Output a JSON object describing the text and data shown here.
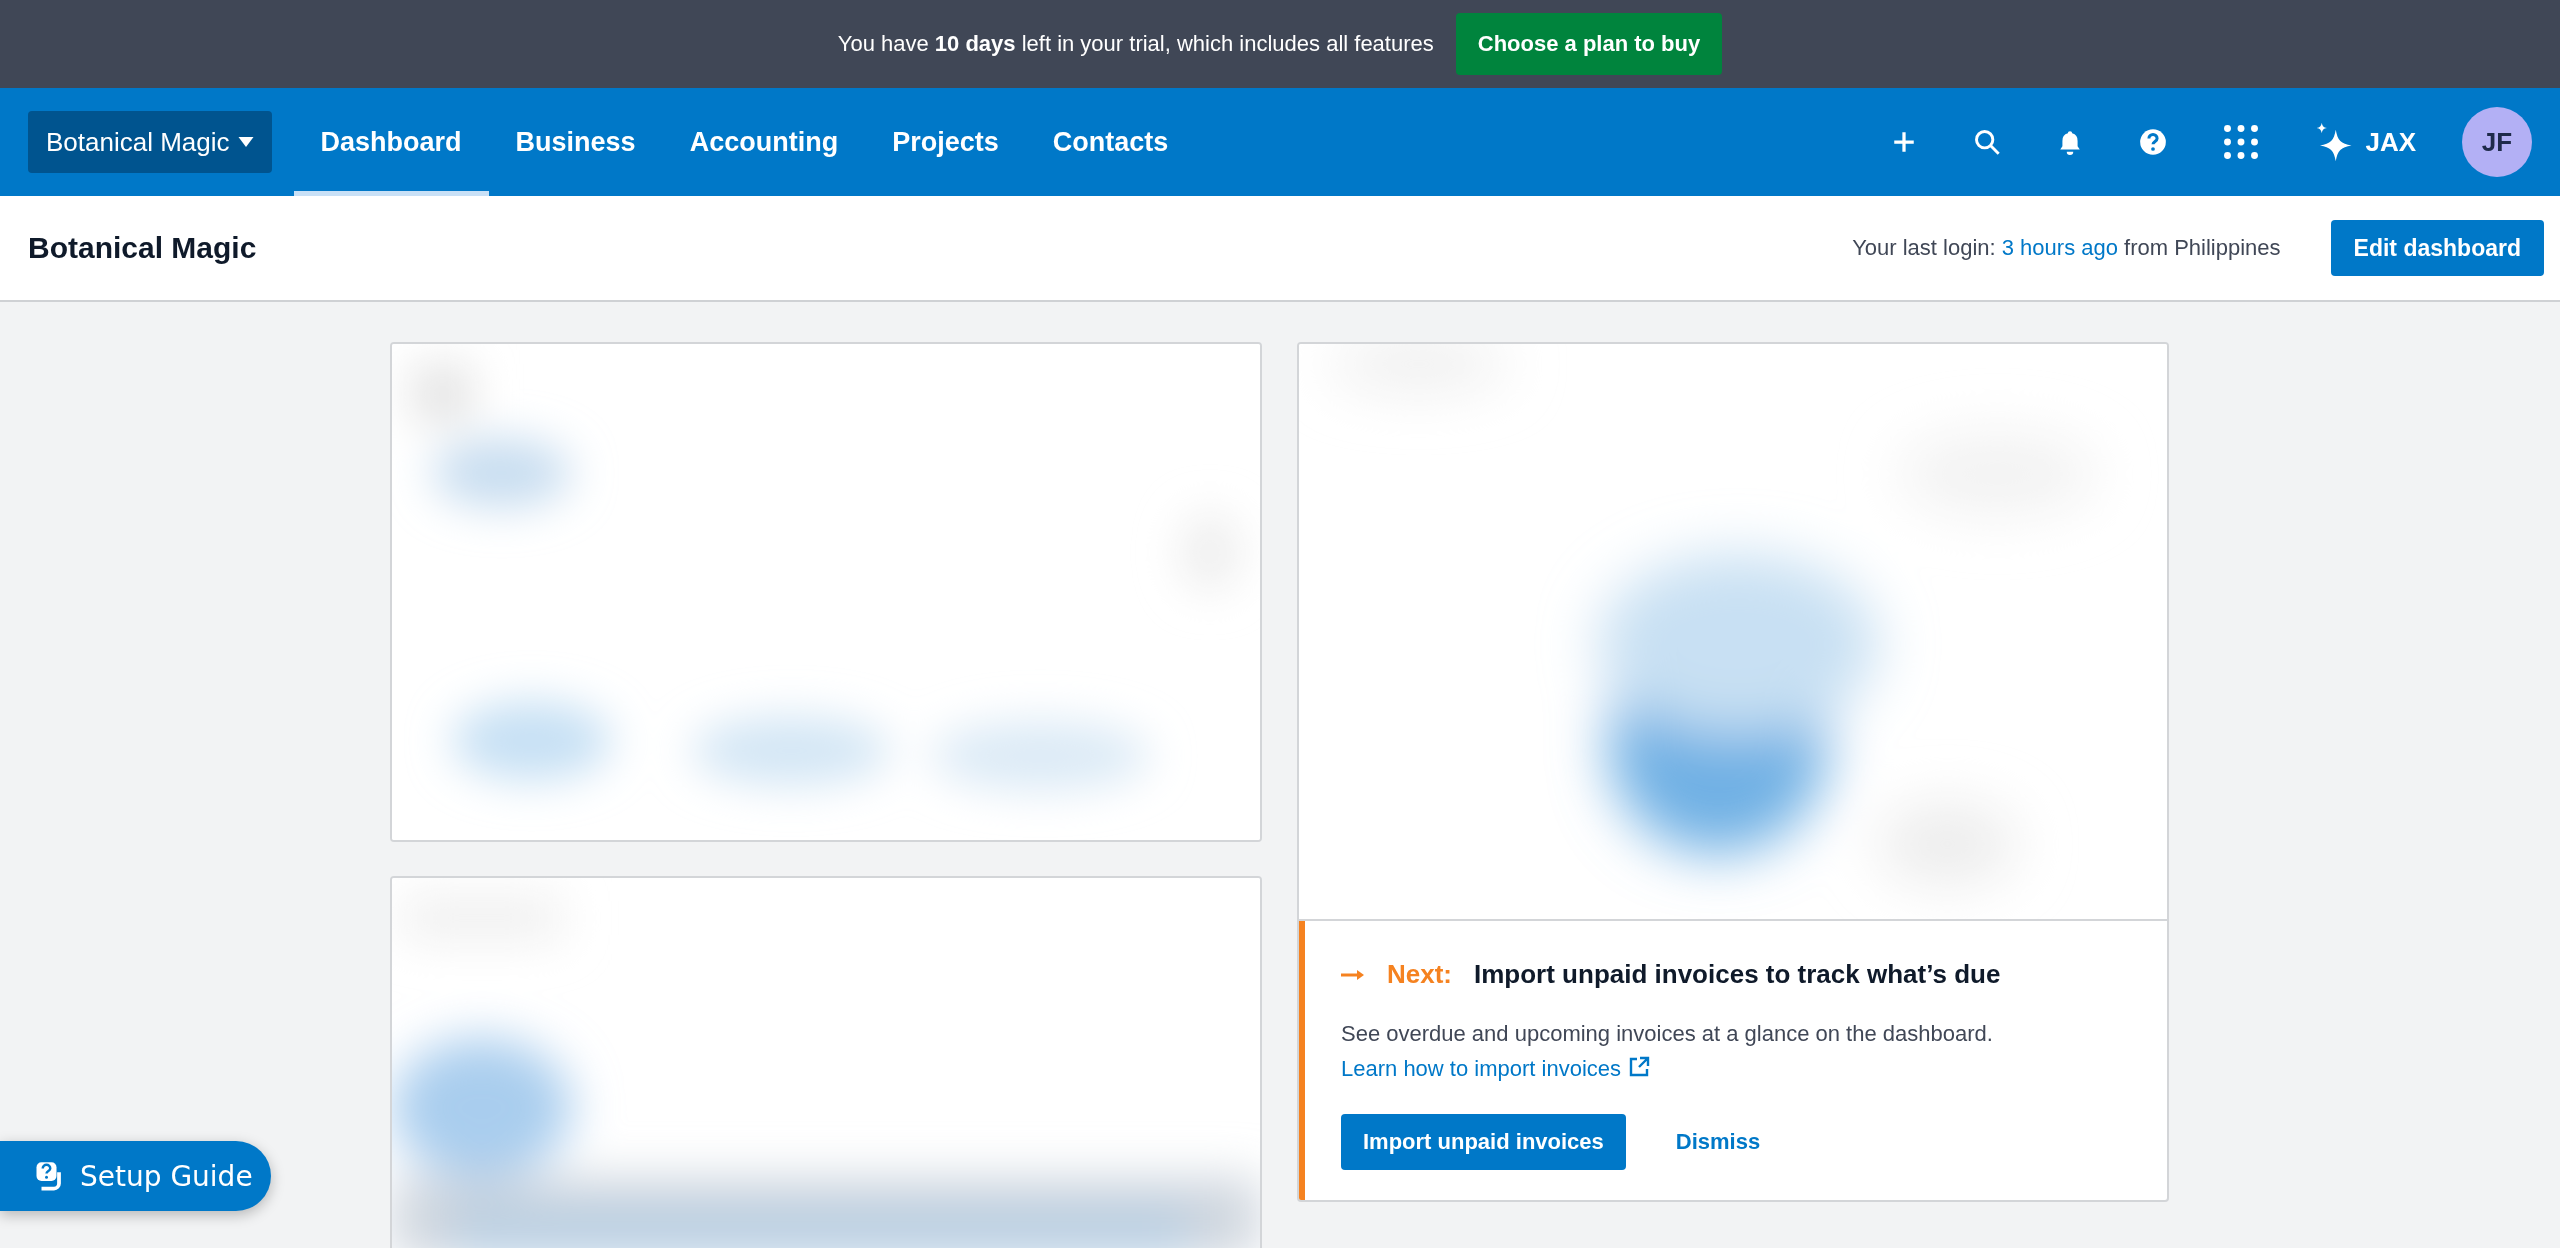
{
  "trial_banner": {
    "message": "You have **10 days** left in your trial, which includes all features",
    "button": "Choose a plan to buy"
  },
  "nav": {
    "org_switcher": "Botanical Magic",
    "tabs": [
      {
        "label": "Dashboard",
        "selected": true
      },
      {
        "label": "Business",
        "selected": false
      },
      {
        "label": "Accounting",
        "selected": false
      },
      {
        "label": "Projects",
        "selected": false
      },
      {
        "label": "Contacts",
        "selected": false
      }
    ],
    "assistant": "JAX",
    "avatar": "JF"
  },
  "page_header": {
    "title": "Botanical Magic",
    "last_login_prefix": "Your last login:",
    "last_login_link": "3 hours ago",
    "last_login_suffix": "from Philippines",
    "button": "Edit dashboard"
  },
  "prompt_card": {
    "label": "Next:",
    "title": "Import unpaid invoices to track what’s due",
    "text": "See overdue and upcoming invoices at a glance on the dashboard.",
    "link": "Learn how to import invoices",
    "primary_button": "Import unpaid invoices",
    "secondary_button": "Dismiss"
  },
  "setup_guide": {
    "label": "Setup Guide"
  }
}
